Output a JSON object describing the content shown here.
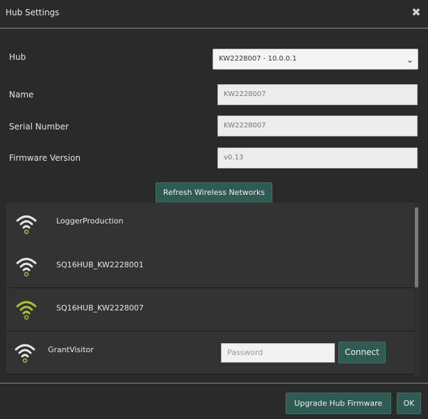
{
  "dialog": {
    "title": "Hub Settings",
    "close_icon": "close-icon"
  },
  "form": {
    "hub_label": "Hub",
    "hub_value": "KW2228007 - 10.0.0.1",
    "name_label": "Name",
    "name_value": "KW2228007",
    "serial_label": "Serial Number",
    "serial_value": "KW2228007",
    "firmware_label": "Firmware Version",
    "firmware_value": "v0.13"
  },
  "buttons": {
    "refresh": "Refresh Wireless Networks",
    "connect": "Connect",
    "upgrade": "Upgrade Hub Firmware",
    "ok": "OK"
  },
  "networks": [
    {
      "name": "LoggerProduction",
      "icon": "wifi-icon",
      "color": "#e6e6e6"
    },
    {
      "name": "SQ16HUB_KW2228001",
      "icon": "wifi-icon",
      "color": "#e6e6e6"
    },
    {
      "name": "SQ16HUB_KW2228007",
      "icon": "wifi-icon",
      "color": "#a8c23a"
    },
    {
      "name": "GrantVisitor",
      "icon": "wifi-icon",
      "color": "#e6e6e6"
    }
  ],
  "password_placeholder": "Password"
}
